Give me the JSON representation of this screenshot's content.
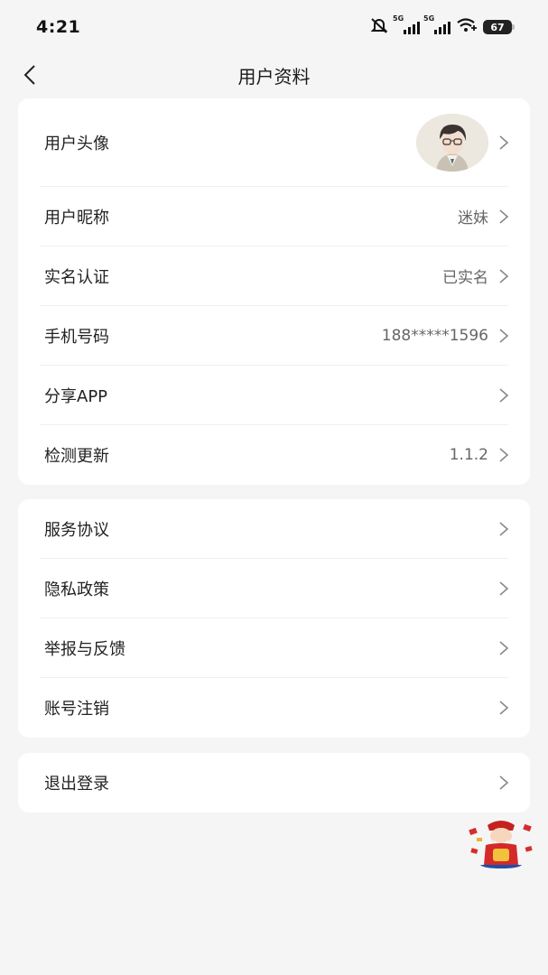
{
  "status_bar": {
    "time": "4:21",
    "network_labels": [
      "5G",
      "5G"
    ],
    "battery": "67"
  },
  "header": {
    "title": "用户资料"
  },
  "profile_section": {
    "items": [
      {
        "label": "用户头像",
        "value": ""
      },
      {
        "label": "用户昵称",
        "value": "迷妹"
      },
      {
        "label": "实名认证",
        "value": "已实名"
      },
      {
        "label": "手机号码",
        "value": "188*****1596"
      },
      {
        "label": "分享APP",
        "value": ""
      },
      {
        "label": "检测更新",
        "value": "1.1.2"
      }
    ]
  },
  "policy_section": {
    "items": [
      {
        "label": "服务协议"
      },
      {
        "label": "隐私政策"
      },
      {
        "label": "举报与反馈"
      },
      {
        "label": "账号注销"
      }
    ]
  },
  "logout_section": {
    "label": "退出登录"
  },
  "icons": {
    "back": "chevron-left-icon",
    "row_arrow": "chevron-right-icon",
    "mute": "bell-off-icon",
    "wifi": "wifi-icon"
  },
  "colors": {
    "background": "#f5f5f5",
    "card": "#ffffff",
    "value_text": "#666666",
    "divider": "#efefef"
  }
}
